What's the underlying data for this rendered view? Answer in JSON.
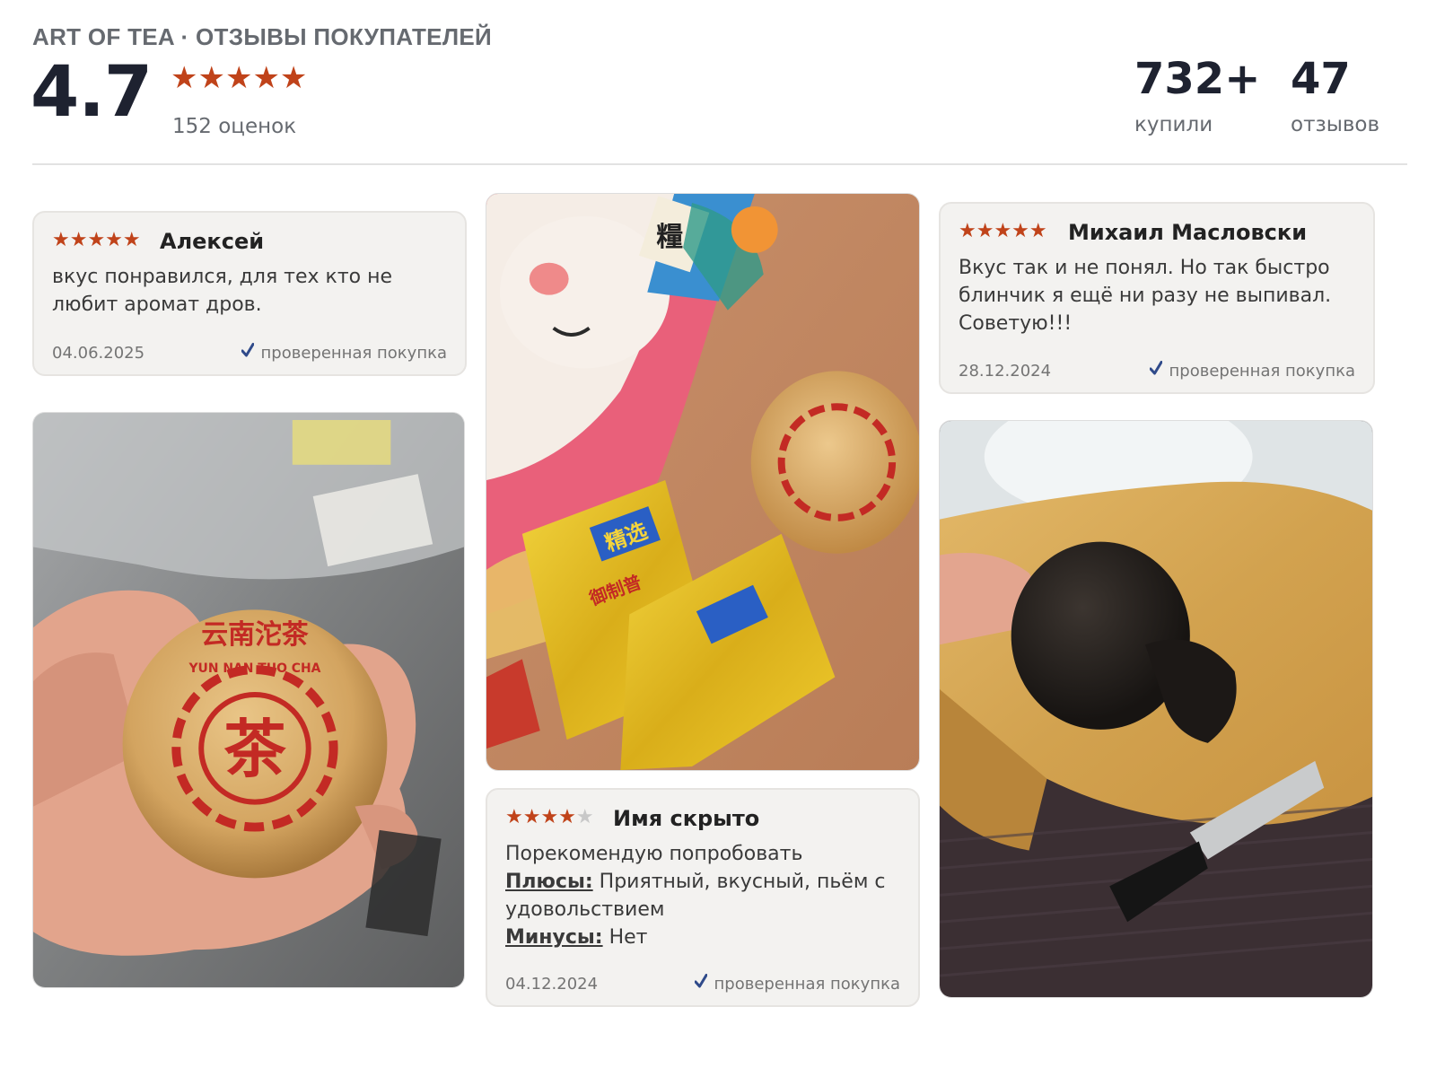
{
  "header": {
    "brand": "ART OF TEA · ОТЗЫВЫ ПОКУПАТЕЛЕЙ",
    "rating": "4.7",
    "rating_stars": "★★★★★",
    "rating_count": "152 оценок",
    "stats": [
      {
        "value": "732+",
        "label": "купили"
      },
      {
        "value": "47",
        "label": "отзывов"
      }
    ]
  },
  "reviews": [
    {
      "stars": 5,
      "stars_on": "★★★★★",
      "stars_off": "",
      "author": "Алексей",
      "text": "вкус понравился, для тех кто не любит аромат дров.",
      "date": "04.06.2025",
      "verified": "проверенная покупка"
    },
    {
      "stars": 4,
      "stars_on": "★★★★",
      "stars_off": "★",
      "author": "Имя скрыто",
      "text": "Порекомендую попробовать",
      "plus_label": "Плюсы:",
      "plus_text": " Приятный, вкусный, пьём с удовольствием",
      "minus_label": "Минусы:",
      "minus_text": " Нет",
      "date": "04.12.2024",
      "verified": "проверенная покупка"
    },
    {
      "stars": 5,
      "stars_on": "★★★★★",
      "stars_off": "",
      "author": "Михаил Масловски",
      "text": "Вкус так и не понял. Но так быстро блинчик я ещё ни разу не выпивал. Советую!!!",
      "date": "28.12.2024",
      "verified": "проверенная покупка"
    }
  ],
  "photos": [
    {
      "name": "photo-tea-ball-in-hand",
      "printed_text": [
        "云南沱茶",
        "YUN NAN TUO CHA",
        "茶"
      ]
    },
    {
      "name": "photo-tea-packages",
      "printed_text": [
        "精选",
        "御制普",
        "糧"
      ]
    },
    {
      "name": "photo-broken-tea-ball",
      "printed_text": []
    }
  ],
  "colors": {
    "star": "#c0431a",
    "verified_check": "#2f4a8a",
    "card_bg": "#f3f2f0",
    "heading": "#1e2230"
  },
  "icons": [
    "star-icon",
    "check-icon"
  ]
}
